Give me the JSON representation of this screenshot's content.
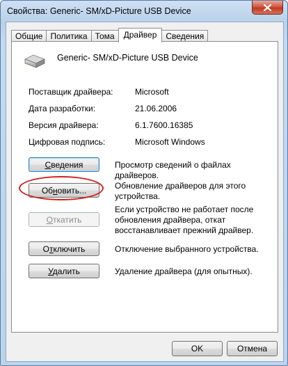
{
  "window": {
    "title": "Свойства: Generic- SM/xD-Picture USB Device"
  },
  "tabs": [
    {
      "label": "Общие"
    },
    {
      "label": "Политика"
    },
    {
      "label": "Тома"
    },
    {
      "label": "Драйвер"
    },
    {
      "label": "Сведения"
    }
  ],
  "active_tab": "Драйвер",
  "device": {
    "name": "Generic- SM/xD-Picture USB Device",
    "icon": "usb-drive-icon"
  },
  "driver_info": {
    "provider_label": "Поставщик драйвера:",
    "provider_value": "Microsoft",
    "date_label": "Дата разработки:",
    "date_value": "21.06.2006",
    "version_label": "Версия драйвера:",
    "version_value": "6.1.7600.16385",
    "signer_label": "Цифровая подпись:",
    "signer_value": "Microsoft Windows"
  },
  "actions": {
    "details": {
      "pre": "",
      "key": "С",
      "post": "ведения",
      "desc": "Просмотр сведений о файлах драйверов."
    },
    "update": {
      "pre": "Об",
      "key": "н",
      "post": "овить...",
      "desc": "Обновление драйверов для этого устройства."
    },
    "rollback": {
      "pre": "",
      "key": "О",
      "post": "ткатить",
      "desc": "Если устройство не работает после обновления драйвера, откат восстанавливает прежний драйвер."
    },
    "disable": {
      "pre": "О",
      "key": "т",
      "post": "ключить",
      "desc": "Отключение выбранного устройства."
    },
    "uninstall": {
      "pre": "",
      "key": "У",
      "post": "далить",
      "desc": "Удаление драйвера (для опытных)."
    }
  },
  "footer": {
    "ok_label": "OK",
    "cancel_label": "Отмена"
  },
  "colors": {
    "highlight_ellipse": "#d21d20",
    "close_button": "#c23a23",
    "frame": "#b9d1ea"
  }
}
